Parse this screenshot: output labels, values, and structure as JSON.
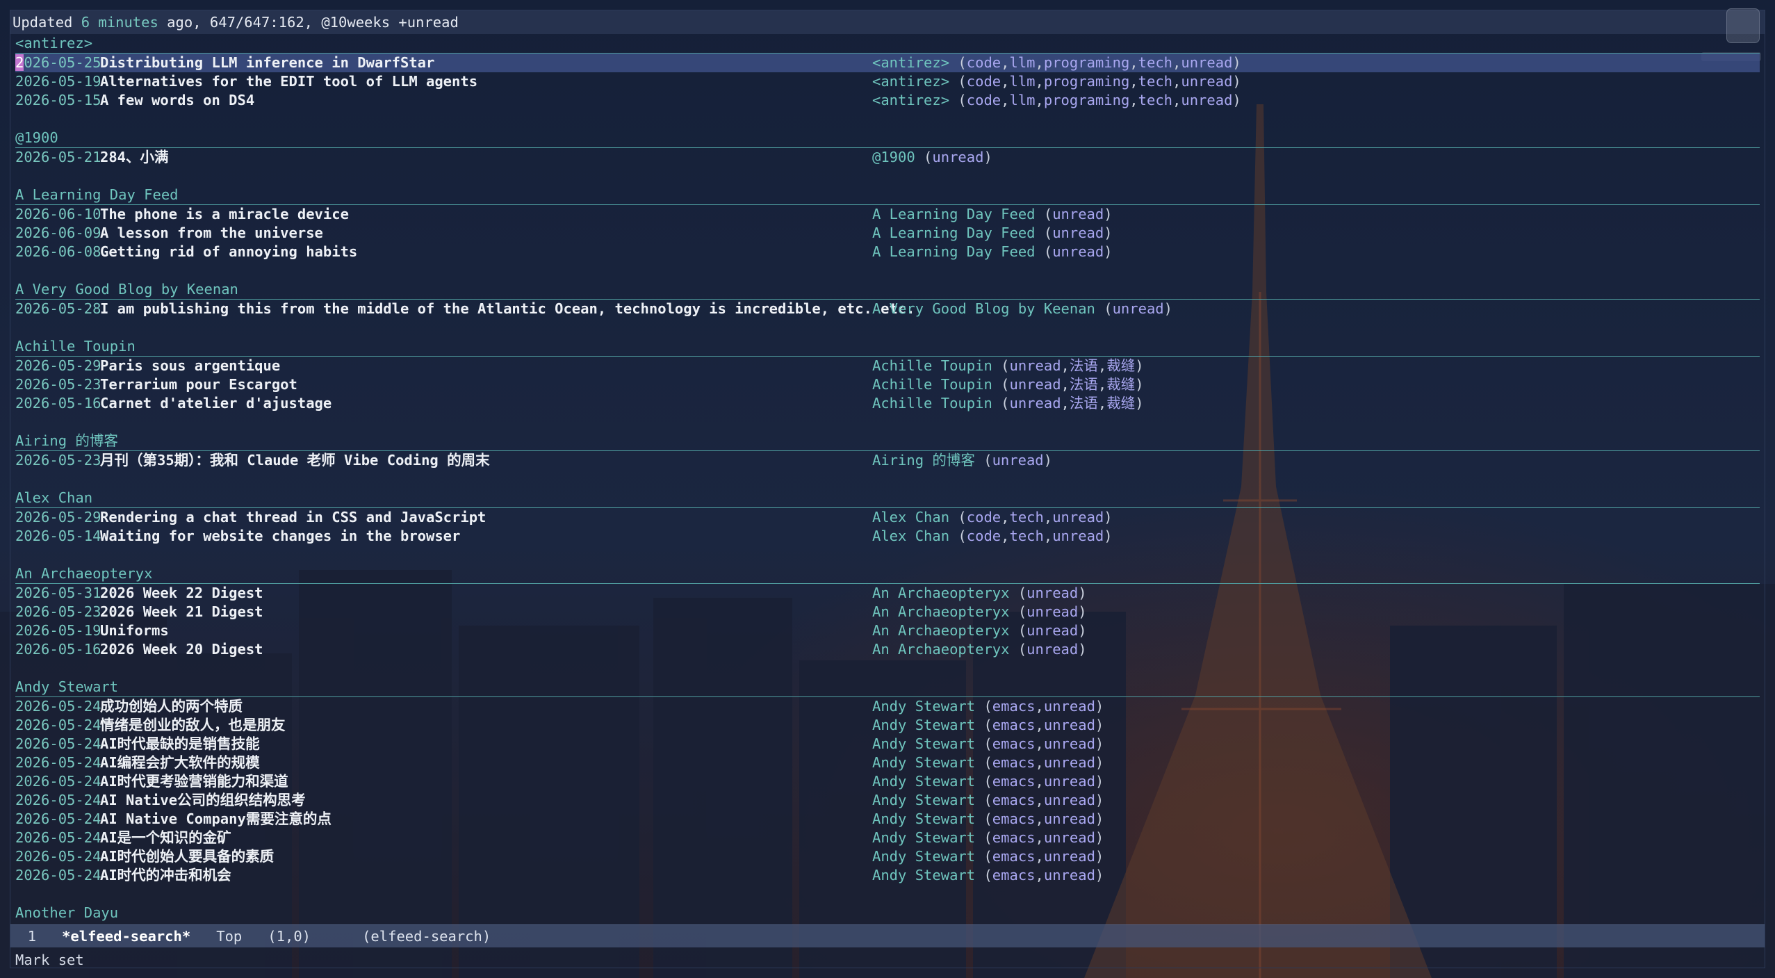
{
  "header": {
    "prefix": "Updated ",
    "minutes": "6 minutes",
    "suffix": " ago, 647/647:162, @10weeks +unread"
  },
  "groups": [
    {
      "name": "<antirez>",
      "entries": [
        {
          "date": "2026-05-25",
          "title": "Distributing LLM inference in DwarfStar",
          "feed": "<antirez>",
          "tags": [
            "code",
            "llm",
            "programing",
            "tech",
            "unread"
          ]
        },
        {
          "date": "2026-05-19",
          "title": "Alternatives for the EDIT tool of LLM agents",
          "feed": "<antirez>",
          "tags": [
            "code",
            "llm",
            "programing",
            "tech",
            "unread"
          ]
        },
        {
          "date": "2026-05-15",
          "title": "A few words on DS4",
          "feed": "<antirez>",
          "tags": [
            "code",
            "llm",
            "programing",
            "tech",
            "unread"
          ]
        }
      ]
    },
    {
      "name": "@1900",
      "entries": [
        {
          "date": "2026-05-21",
          "title": "284、小满",
          "feed": "@1900",
          "tags": [
            "unread"
          ]
        }
      ]
    },
    {
      "name": "A Learning Day Feed",
      "entries": [
        {
          "date": "2026-06-10",
          "title": "The phone is a miracle device",
          "feed": "A Learning Day Feed",
          "tags": [
            "unread"
          ]
        },
        {
          "date": "2026-06-09",
          "title": "A lesson from the universe",
          "feed": "A Learning Day Feed",
          "tags": [
            "unread"
          ]
        },
        {
          "date": "2026-06-08",
          "title": "Getting rid of annoying habits",
          "feed": "A Learning Day Feed",
          "tags": [
            "unread"
          ]
        }
      ]
    },
    {
      "name": "A Very Good Blog by Keenan",
      "entries": [
        {
          "date": "2026-05-28",
          "title": "I am publishing this from the middle of the Atlantic Ocean, technology is incredible, etc. etc.",
          "feed": "A Very Good Blog by Keenan",
          "tags": [
            "unread"
          ]
        }
      ]
    },
    {
      "name": "Achille Toupin",
      "entries": [
        {
          "date": "2026-05-29",
          "title": "Paris sous argentique",
          "feed": "Achille Toupin",
          "tags": [
            "unread",
            "法语",
            "裁缝"
          ]
        },
        {
          "date": "2026-05-23",
          "title": "Terrarium pour Escargot",
          "feed": "Achille Toupin",
          "tags": [
            "unread",
            "法语",
            "裁缝"
          ]
        },
        {
          "date": "2026-05-16",
          "title": "Carnet d'atelier d'ajustage",
          "feed": "Achille Toupin",
          "tags": [
            "unread",
            "法语",
            "裁缝"
          ]
        }
      ]
    },
    {
      "name": "Airing 的博客",
      "entries": [
        {
          "date": "2026-05-23",
          "title": "月刊（第35期）：我和 Claude 老师 Vibe Coding 的周末",
          "feed": "Airing 的博客",
          "tags": [
            "unread"
          ]
        }
      ]
    },
    {
      "name": "Alex Chan",
      "entries": [
        {
          "date": "2026-05-29",
          "title": "Rendering a chat thread in CSS and JavaScript",
          "feed": "Alex Chan",
          "tags": [
            "code",
            "tech",
            "unread"
          ]
        },
        {
          "date": "2026-05-14",
          "title": "Waiting for website changes in the browser",
          "feed": "Alex Chan",
          "tags": [
            "code",
            "tech",
            "unread"
          ]
        }
      ]
    },
    {
      "name": "An Archaeopteryx",
      "entries": [
        {
          "date": "2026-05-31",
          "title": "2026 Week 22 Digest",
          "feed": "An Archaeopteryx",
          "tags": [
            "unread"
          ]
        },
        {
          "date": "2026-05-23",
          "title": "2026 Week 21 Digest",
          "feed": "An Archaeopteryx",
          "tags": [
            "unread"
          ]
        },
        {
          "date": "2026-05-19",
          "title": "Uniforms",
          "feed": "An Archaeopteryx",
          "tags": [
            "unread"
          ]
        },
        {
          "date": "2026-05-16",
          "title": "2026 Week 20 Digest",
          "feed": "An Archaeopteryx",
          "tags": [
            "unread"
          ]
        }
      ]
    },
    {
      "name": "Andy Stewart",
      "entries": [
        {
          "date": "2026-05-24",
          "title": "成功创始人的两个特质",
          "feed": "Andy Stewart",
          "tags": [
            "emacs",
            "unread"
          ]
        },
        {
          "date": "2026-05-24",
          "title": "情绪是创业的敌人，也是朋友",
          "feed": "Andy Stewart",
          "tags": [
            "emacs",
            "unread"
          ]
        },
        {
          "date": "2026-05-24",
          "title": "AI时代最缺的是销售技能",
          "feed": "Andy Stewart",
          "tags": [
            "emacs",
            "unread"
          ]
        },
        {
          "date": "2026-05-24",
          "title": "AI编程会扩大软件的规模",
          "feed": "Andy Stewart",
          "tags": [
            "emacs",
            "unread"
          ]
        },
        {
          "date": "2026-05-24",
          "title": "AI时代更考验营销能力和渠道",
          "feed": "Andy Stewart",
          "tags": [
            "emacs",
            "unread"
          ]
        },
        {
          "date": "2026-05-24",
          "title": "AI Native公司的组织结构思考",
          "feed": "Andy Stewart",
          "tags": [
            "emacs",
            "unread"
          ]
        },
        {
          "date": "2026-05-24",
          "title": "AI Native Company需要注意的点",
          "feed": "Andy Stewart",
          "tags": [
            "emacs",
            "unread"
          ]
        },
        {
          "date": "2026-05-24",
          "title": "AI是一个知识的金矿",
          "feed": "Andy Stewart",
          "tags": [
            "emacs",
            "unread"
          ]
        },
        {
          "date": "2026-05-24",
          "title": "AI时代创始人要具备的素质",
          "feed": "Andy Stewart",
          "tags": [
            "emacs",
            "unread"
          ]
        },
        {
          "date": "2026-05-24",
          "title": "AI时代的冲击和机会",
          "feed": "Andy Stewart",
          "tags": [
            "emacs",
            "unread"
          ]
        }
      ]
    },
    {
      "name": "Another Dayu",
      "entries": []
    }
  ],
  "modeline": {
    "line": "1",
    "buffer": "*elfeed-search*",
    "position": "Top",
    "coords": "(1,0)",
    "mode": "(elfeed-search)"
  },
  "minibuffer": {
    "message": "Mark set"
  },
  "colors": {
    "background": "#17213a",
    "date": "#79c7bf",
    "feed": "#6fc5be",
    "tag": "#a9a7f0",
    "cursor": "#c377d0",
    "current_line": "#40528a"
  }
}
